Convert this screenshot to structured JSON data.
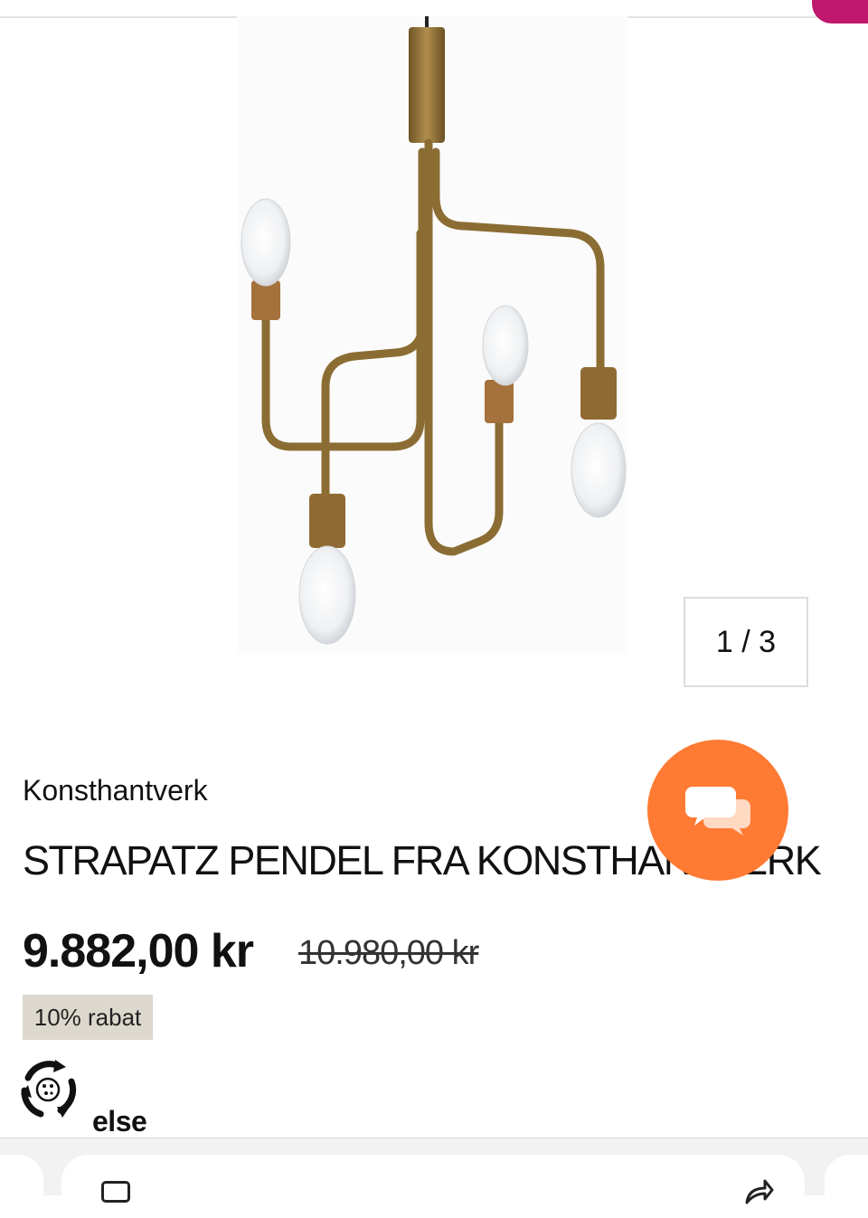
{
  "product": {
    "brand": "Konsthantverk",
    "title": "STRAPATZ PENDEL FRA KONSTHANTVERK",
    "price": "9.882,00 kr",
    "old_price": "10.980,00 kr",
    "discount_badge": "10% rabat",
    "image_counter": "1 / 3",
    "image_icon": "pendant-lamp-image"
  },
  "payment": {
    "provider_label": "else",
    "icon": "else-logo-icon"
  },
  "chat": {
    "icon": "chat-bubbles-icon",
    "color": "#ff7a33"
  },
  "browser": {
    "tabs_icon": "tabs-icon",
    "share_icon": "share-icon"
  },
  "colors": {
    "accent_pink": "#c0186e",
    "chat_orange": "#ff7a33",
    "badge_bg": "#ddd8cd",
    "brass": "#9a7b3a"
  }
}
